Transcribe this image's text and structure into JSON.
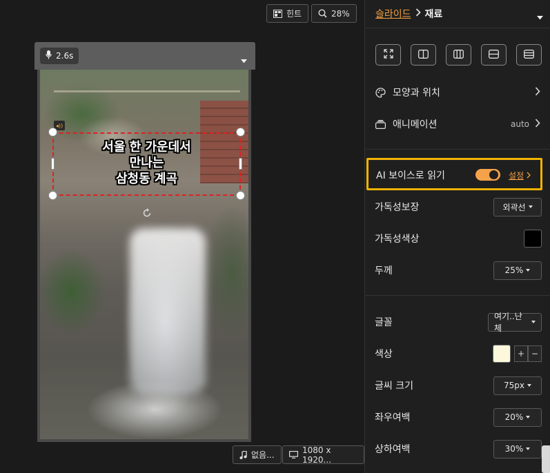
{
  "toolbar": {
    "hint_label": "힌트",
    "zoom_label": "28%"
  },
  "frame": {
    "voice_duration": "2.6s"
  },
  "caption": {
    "line1": "서울 한 가운데서",
    "line2": "만나는",
    "line3": "삼청동 계곡"
  },
  "bottom": {
    "audio_label": "없음...",
    "resolution_label": "1080 x 1920..."
  },
  "panel": {
    "breadcrumb_parent": "슬라이드",
    "breadcrumb_current": "재료",
    "menu": {
      "shape_position": "모양과 위치",
      "animation": "애니메이션",
      "animation_value": "auto"
    },
    "ai_voice": {
      "label": "AI 보이스로 읽기",
      "settings_link": "설정",
      "enabled": true
    },
    "props": {
      "readability_guard": {
        "label": "가독성보장",
        "value": "외곽선"
      },
      "readability_color": {
        "label": "가독성색상",
        "color": "#000000"
      },
      "thickness": {
        "label": "두께",
        "value": "25%"
      },
      "font": {
        "label": "글꼴",
        "value": "여기..난체"
      },
      "color": {
        "label": "색상",
        "color": "#fdf8dc"
      },
      "font_size": {
        "label": "글씨 크기",
        "value": "75px"
      },
      "h_margin": {
        "label": "좌우여백",
        "value": "20%"
      },
      "v_margin": {
        "label": "상하여백",
        "value": "30%"
      }
    }
  },
  "colors": {
    "accent": "#f0a040",
    "highlight": "#f2b400"
  }
}
